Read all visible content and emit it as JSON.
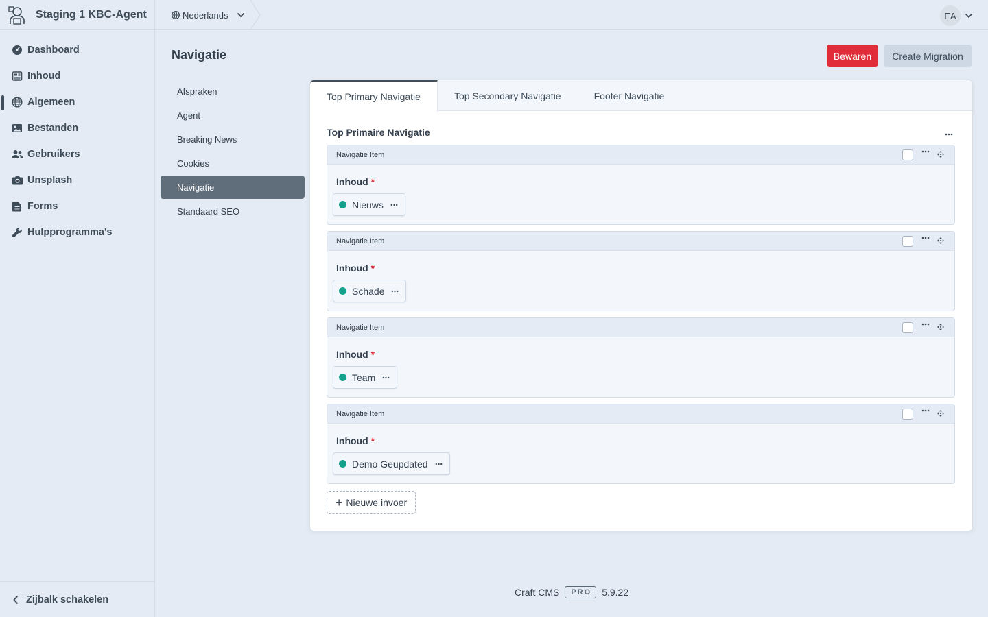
{
  "site": {
    "name": "Staging 1 KBC-Agent",
    "logo_icon": "agent-logo-icon"
  },
  "global_nav": {
    "items": [
      {
        "label": "Dashboard",
        "icon": "gauge-icon"
      },
      {
        "label": "Inhoud",
        "icon": "newspaper-icon"
      },
      {
        "label": "Algemeen",
        "icon": "globe-icon",
        "selected": true
      },
      {
        "label": "Bestanden",
        "icon": "image-icon"
      },
      {
        "label": "Gebruikers",
        "icon": "users-icon"
      },
      {
        "label": "Unsplash",
        "icon": "camera-icon"
      },
      {
        "label": "Forms",
        "icon": "file-icon"
      },
      {
        "label": "Hulpprogramma's",
        "icon": "wrench-icon"
      }
    ],
    "collapse_label": "Zijbalk schakelen"
  },
  "header": {
    "language": "Nederlands",
    "user_initials": "EA"
  },
  "page": {
    "title": "Navigatie",
    "save_label": "Bewaren",
    "migration_label": "Create Migration"
  },
  "subnav": {
    "items": [
      {
        "label": "Afspraken"
      },
      {
        "label": "Agent"
      },
      {
        "label": "Breaking News"
      },
      {
        "label": "Cookies"
      },
      {
        "label": "Navigatie",
        "selected": true
      },
      {
        "label": "Standaard SEO"
      }
    ]
  },
  "tabs": [
    {
      "label": "Top Primary Navigatie",
      "selected": true
    },
    {
      "label": "Top Secondary Navigatie"
    },
    {
      "label": "Footer Navigatie"
    }
  ],
  "field": {
    "heading": "Top Primaire Navigatie",
    "blocks": [
      {
        "type": "Navigatie Item",
        "label": "Inhoud",
        "required_mark": "*",
        "entry": "Nieuws",
        "status_color": "#14a08b"
      },
      {
        "type": "Navigatie Item",
        "label": "Inhoud",
        "required_mark": "*",
        "entry": "Schade",
        "status_color": "#14a08b"
      },
      {
        "type": "Navigatie Item",
        "label": "Inhoud",
        "required_mark": "*",
        "entry": "Team",
        "status_color": "#14a08b"
      },
      {
        "type": "Navigatie Item",
        "label": "Inhoud",
        "required_mark": "*",
        "entry": "Demo Geupdated",
        "status_color": "#14a08b"
      }
    ],
    "add_label": "Nieuwe invoer"
  },
  "footer": {
    "product": "Craft CMS",
    "edition": "PRO",
    "version": "5.9.22"
  },
  "colors": {
    "accent": "#e12d39",
    "status_live": "#14a08b",
    "sidebar_selected": "#606d7b"
  }
}
